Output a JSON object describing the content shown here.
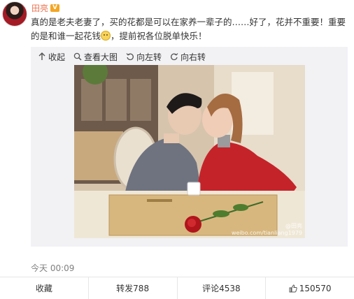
{
  "user": {
    "name": "田亮",
    "verify_badge": "V"
  },
  "post": {
    "text_before_emoji": "真的是老夫老妻了，买的花都是可以在家养一辈子的……好了，花并不重要！重要的是和谁一起花钱",
    "text_after_emoji": "，提前祝各位脱单快乐！",
    "emoji": "smile-emoji"
  },
  "media_toolbar": {
    "collapse": "收起",
    "view_large": "查看大图",
    "rotate_left": "向左转",
    "rotate_right": "向右转"
  },
  "photo": {
    "watermark_line1": "@田亮",
    "watermark_line2": "weibo.com/tianliang1979"
  },
  "timestamp": "今天 00:09",
  "actions": {
    "favorite": "收藏",
    "repost": "转发788",
    "comment": "评论4538",
    "like": "150570"
  },
  "colors": {
    "username": "#eb7350",
    "badge": "#f5a623",
    "media_bg": "#f2f2f5"
  }
}
